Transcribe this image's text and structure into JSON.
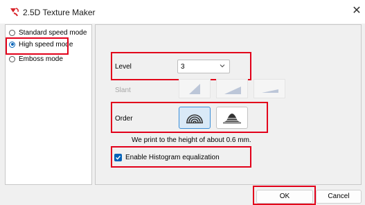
{
  "window": {
    "title": "2.5D Texture Maker",
    "app_icon": "texture-maker-logo",
    "close_glyph": "✕"
  },
  "modes": {
    "items": [
      {
        "label": "Standard speed mode",
        "checked": false
      },
      {
        "label": "High speed mode",
        "checked": true
      },
      {
        "label": "Emboss mode",
        "checked": false
      }
    ]
  },
  "settings": {
    "level_label": "Level",
    "level_value": "3",
    "slant_label": "Slant",
    "order_label": "Order",
    "height_note": "We print to the height of about 0.6 mm.",
    "histogram_label": "Enable Histogram equalization",
    "histogram_checked": true
  },
  "buttons": {
    "ok": "OK",
    "cancel": "Cancel"
  },
  "colors": {
    "accent": "#0062b8",
    "highlight_box": "#e2001a",
    "selected_button_bg": "#d9e9f7"
  }
}
